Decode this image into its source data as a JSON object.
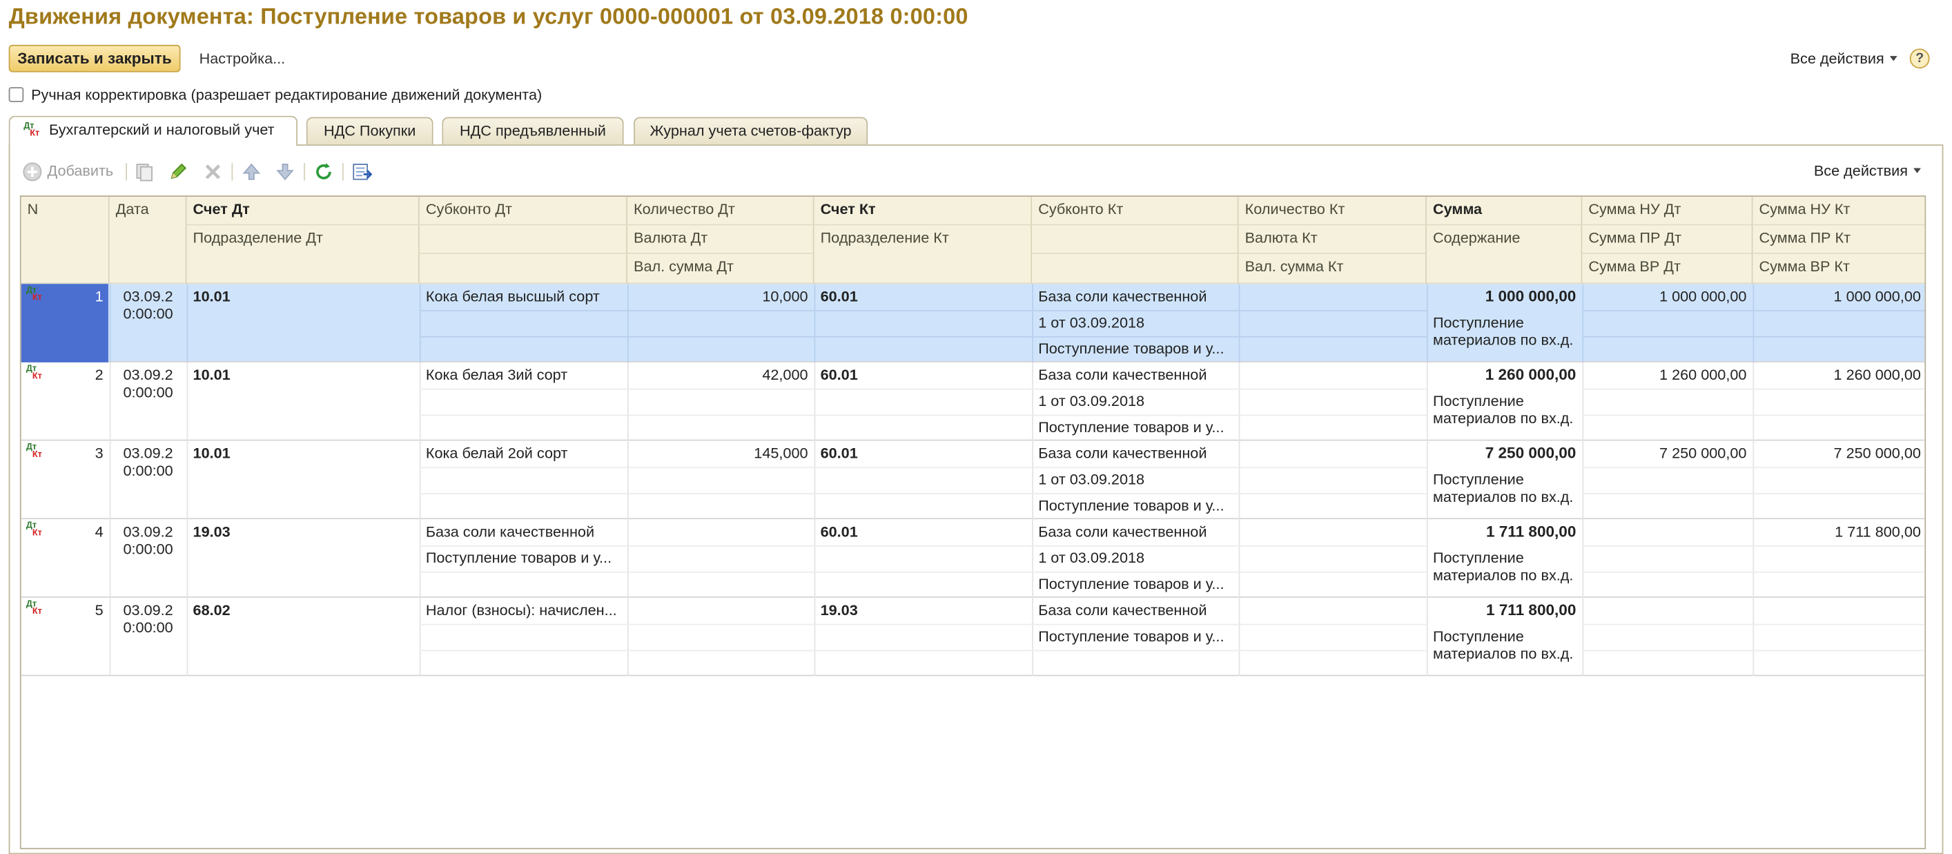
{
  "window": {
    "title": "Движения документа: Поступление товаров и услуг 0000-000001 от 03.09.2018 0:00:00"
  },
  "toolbar": {
    "save_close": "Записать и закрыть",
    "settings": "Настройка...",
    "all_actions": "Все действия",
    "help": "?"
  },
  "manual": {
    "label": "Ручная корректировка (разрешает редактирование движений документа)",
    "checked": false
  },
  "tabs": [
    {
      "label": "Бухгалтерский и налоговый учет",
      "icon_dt": "Дт",
      "icon_kt": "Кт"
    },
    {
      "label": "НДС Покупки"
    },
    {
      "label": "НДС предъявленный"
    },
    {
      "label": "Журнал учета счетов-фактур"
    }
  ],
  "table_toolbar": {
    "add": "Добавить",
    "all_actions": "Все действия",
    "icons": [
      "add-icon",
      "copy-icon",
      "edit-icon",
      "delete-icon",
      "move-up-icon",
      "move-down-icon",
      "refresh-icon",
      "export-icon"
    ]
  },
  "headers": {
    "n": "N",
    "date": "Дата",
    "acc_dt": "Счет Дт",
    "dept_dt": "Подразделение Дт",
    "sub_dt": "Субконто Дт",
    "qty_dt": "Количество Дт",
    "cur_dt": "Валюта Дт",
    "cursum_dt": "Вал. сумма Дт",
    "acc_kt": "Счет Кт",
    "dept_kt": "Подразделение Кт",
    "sub_kt": "Субконто Кт",
    "qty_kt": "Количество Кт",
    "cur_kt": "Валюта Кт",
    "cursum_kt": "Вал. сумма Кт",
    "sum": "Сумма",
    "content": "Содержание",
    "nu_dt": "Сумма НУ Дт",
    "pr_dt": "Сумма ПР Дт",
    "vr_dt": "Сумма ВР Дт",
    "nu_kt": "Сумма НУ Кт",
    "pr_kt": "Сумма ПР Кт",
    "vr_kt": "Сумма ВР Кт"
  },
  "rows": [
    {
      "n": "1",
      "date": "03.09.2 0:00:00",
      "acc_dt": "10.01",
      "sub_dt": [
        "Кока белая высшый сорт",
        "",
        ""
      ],
      "qty_dt": "10,000",
      "acc_kt": "60.01",
      "sub_kt": [
        "База соли качественной",
        "1 от 03.09.2018",
        "Поступление товаров и у..."
      ],
      "sum": "1 000 000,00",
      "content": "Поступление материалов по вх.д.",
      "nu_dt": "1 000 000,00",
      "nu_kt": "1 000 000,00",
      "selected": true
    },
    {
      "n": "2",
      "date": "03.09.2 0:00:00",
      "acc_dt": "10.01",
      "sub_dt": [
        "Кока белая 3ий сорт",
        "",
        ""
      ],
      "qty_dt": "42,000",
      "acc_kt": "60.01",
      "sub_kt": [
        "База соли качественной",
        "1 от 03.09.2018",
        "Поступление товаров и у..."
      ],
      "sum": "1 260 000,00",
      "content": "Поступление материалов по вх.д.",
      "nu_dt": "1 260 000,00",
      "nu_kt": "1 260 000,00",
      "selected": false
    },
    {
      "n": "3",
      "date": "03.09.2 0:00:00",
      "acc_dt": "10.01",
      "sub_dt": [
        "Кока белай 2ой сорт",
        "",
        ""
      ],
      "qty_dt": "145,000",
      "acc_kt": "60.01",
      "sub_kt": [
        "База соли качественной",
        "1 от 03.09.2018",
        "Поступление товаров и у..."
      ],
      "sum": "7 250 000,00",
      "content": "Поступление материалов по вх.д.",
      "nu_dt": "7 250 000,00",
      "nu_kt": "7 250 000,00",
      "selected": false
    },
    {
      "n": "4",
      "date": "03.09.2 0:00:00",
      "acc_dt": "19.03",
      "sub_dt": [
        "База соли качественной",
        "Поступление товаров и у...",
        ""
      ],
      "qty_dt": "",
      "acc_kt": "60.01",
      "sub_kt": [
        "База соли качественной",
        "1 от 03.09.2018",
        "Поступление товаров и у..."
      ],
      "sum": "1 711 800,00",
      "content": "Поступление материалов по вх.д.",
      "nu_dt": "",
      "nu_kt": "1 711 800,00",
      "selected": false
    },
    {
      "n": "5",
      "date": "03.09.2 0:00:00",
      "acc_dt": "68.02",
      "sub_dt": [
        "Налог (взносы): начислен...",
        "",
        ""
      ],
      "qty_dt": "",
      "acc_kt": "19.03",
      "sub_kt": [
        "База соли качественной",
        "Поступление товаров и у...",
        ""
      ],
      "sum": "1 711 800,00",
      "content": "Поступление материалов по вх.д.",
      "nu_dt": "",
      "nu_kt": "",
      "selected": false
    }
  ],
  "colors": {
    "title": "#a0791a",
    "selection": "#cfe4fb",
    "header_bg": "#f6f1dd",
    "dt_icon": "#2c7a2c",
    "kt_icon": "#d42020"
  }
}
